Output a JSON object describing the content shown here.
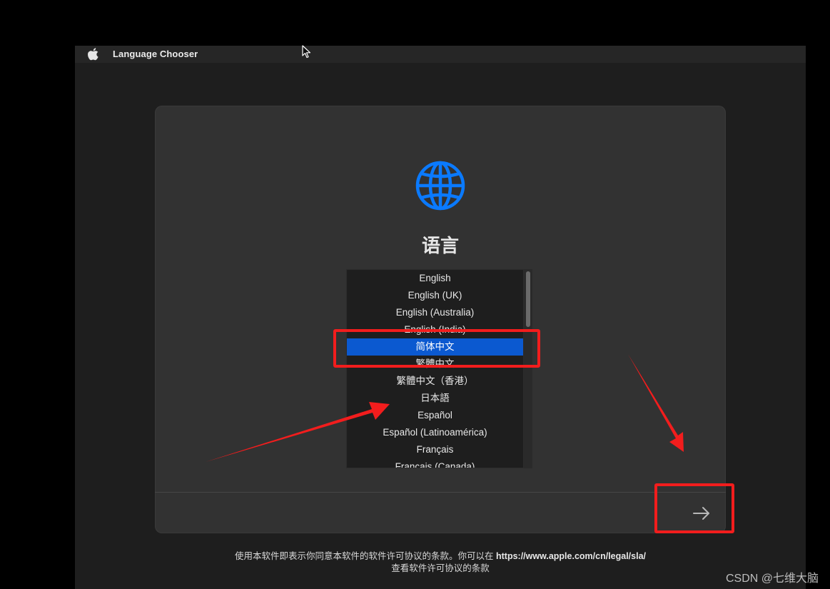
{
  "menubar": {
    "app_name": "Language Chooser",
    "icon": "apple-logo-icon"
  },
  "panel": {
    "icon": "globe-icon",
    "title": "语言",
    "languages": [
      "English",
      "English (UK)",
      "English (Australia)",
      "English (India)",
      "简体中文",
      "繁體中文",
      "繁體中文（香港）",
      "日本語",
      "Español",
      "Español (Latinoamérica)",
      "Français",
      "Français (Canada)"
    ],
    "selected_language": "简体中文",
    "continue_icon": "arrow-right-icon"
  },
  "license": {
    "line1_prefix": "使用本软件即表示你同意本软件的软件许可协议的条款。你可以在",
    "url": "https://www.apple.com/cn/legal/sla/",
    "line2": "查看软件许可协议的条款"
  },
  "watermark": "CSDN @七维大脑",
  "colors": {
    "accent_blue": "#0b59d0",
    "globe_blue": "#0a7aff",
    "annotation_red": "#f21d1d"
  }
}
